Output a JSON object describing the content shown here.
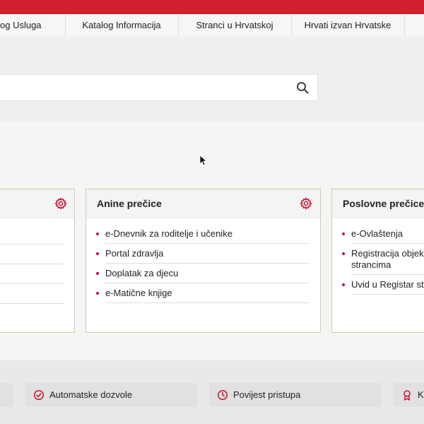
{
  "nav": {
    "items": [
      {
        "label": "og Usluga"
      },
      {
        "label": "Katalog Informacija"
      },
      {
        "label": "Stranci u Hrvatskoj"
      },
      {
        "label": "Hrvati izvan Hrvatske"
      }
    ]
  },
  "search": {
    "value": "",
    "icon": "search-icon"
  },
  "cards": [
    {
      "title": "",
      "icon": "gear-icon",
      "links": []
    },
    {
      "title": "Anine prečice",
      "icon": "gear-icon",
      "links": [
        "e-Dnevnik za roditelje i učenike",
        "Portal zdravlja",
        "Doplatak za djecu",
        "e-Matične knjige"
      ]
    },
    {
      "title": "Poslovne prečice",
      "links": [
        "e-Ovlaštenja",
        "Registracija objeka",
        "strancima",
        "Uvid u Registar stva"
      ]
    }
  ],
  "quick": [
    {
      "label": "Automatske dozvole",
      "icon": "check-circle-icon"
    },
    {
      "label": "Povijest pristupa",
      "icon": "clock-icon"
    },
    {
      "label": "K",
      "icon": "award-icon"
    }
  ],
  "colors": {
    "accent": "#c8102e",
    "topbar": "#d0202e",
    "card_border": "#d9c9a6"
  }
}
